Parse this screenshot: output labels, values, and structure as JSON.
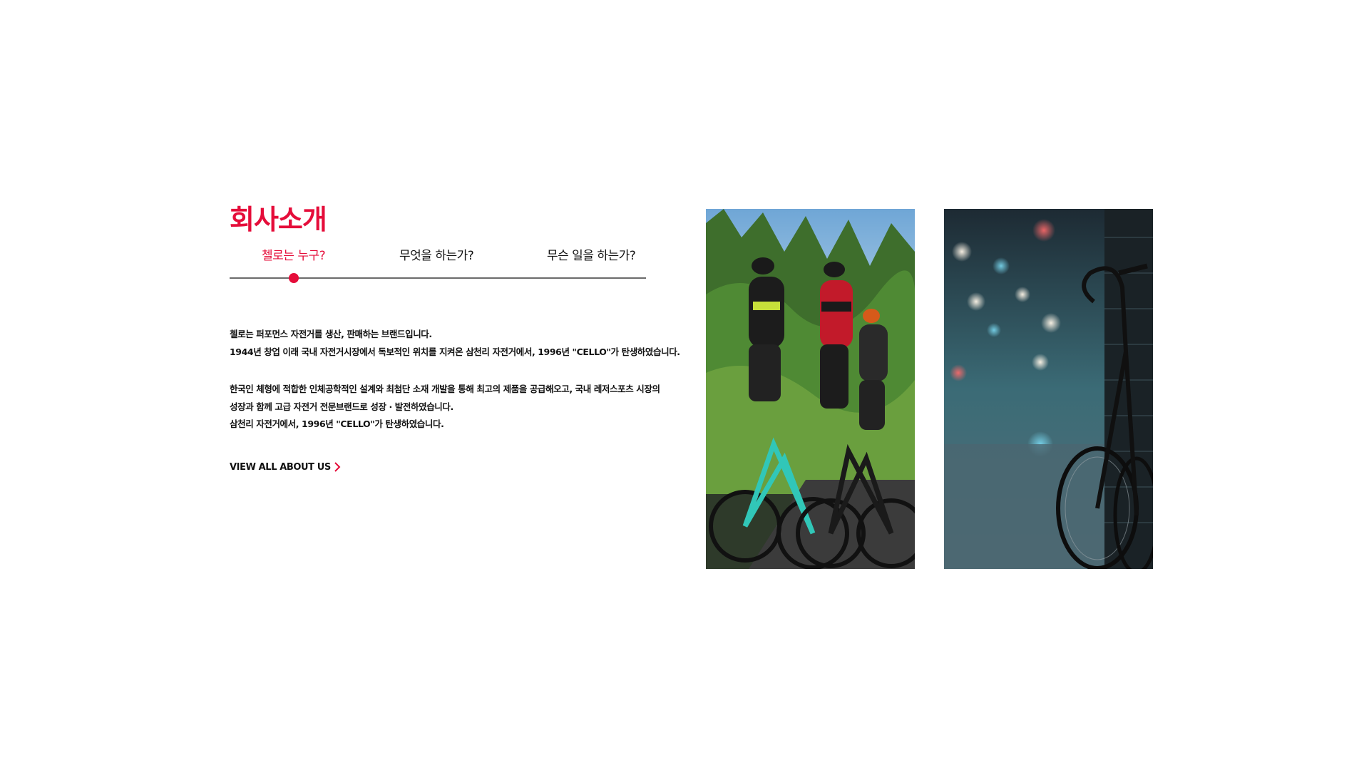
{
  "section": {
    "title": "회사소개",
    "accent_color": "#e50d3a"
  },
  "tabs": [
    {
      "label": "첼로는 누구?",
      "active": true
    },
    {
      "label": "무엇을 하는가?",
      "active": false
    },
    {
      "label": "무슨 일을 하는가?",
      "active": false
    }
  ],
  "description": {
    "para1": [
      "첼로는 퍼포먼스 자전거를 생산, 판매하는 브랜드입니다.",
      "1944년 창업 이래 국내 자전거시장에서 독보적인 위치를 지켜온 삼천리 자전거에서, 1996년 \"CELLO\"가 탄생하였습니다."
    ],
    "para2": [
      "한국인 체형에 적합한 인체공학적인 설계와 최첨단 소재 개발을 통해 최고의 제품을 공급해오고, 국내 레저스포츠 시장의",
      "성장과 함께 고급 자전거 전문브랜드로 성장 · 발전하였습니다.",
      "삼천리 자전거에서, 1996년 \"CELLO\"가 탄생하였습니다."
    ]
  },
  "more_link": {
    "label": "VIEW ALL ABOUT US",
    "icon": "chevron-right-icon"
  },
  "photos": [
    {
      "name": "cyclists-photo",
      "subject": "road cyclists riding"
    },
    {
      "name": "parked-bicycle-photo",
      "subject": "bicycle leaning on wall at night"
    }
  ]
}
